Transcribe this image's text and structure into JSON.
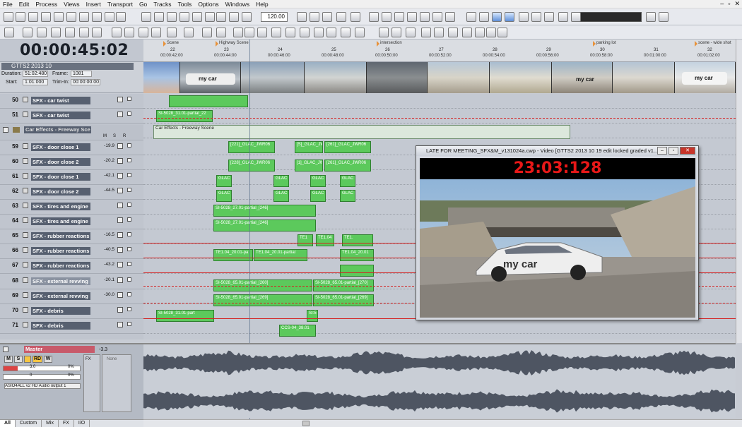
{
  "menu": [
    "File",
    "Edit",
    "Process",
    "Views",
    "Insert",
    "Transport",
    "Go",
    "Tracks",
    "Tools",
    "Options",
    "Windows",
    "Help"
  ],
  "toolbar": {
    "tempo": "120.00"
  },
  "transport": {
    "timecode": "00:00:45:02"
  },
  "clip_info": {
    "name": "GTTS2 2013 10",
    "duration_label": "Duration:",
    "duration": "51:02:480",
    "frame_label": "Frame:",
    "frame": "1081",
    "start_label": "Start:",
    "start": "1:01:000",
    "trim_label": "Trim-In:",
    "trim_in": "00:00:00:00"
  },
  "ruler": {
    "markers": [
      {
        "label": "Scene"
      },
      {
        "label": "Highway Scene"
      },
      {
        "label": "intersection"
      },
      {
        "label": "parking lot"
      },
      {
        "label": "scene - wide shot"
      }
    ],
    "ticks": [
      "22",
      "23",
      "24",
      "25",
      "26",
      "27",
      "28",
      "29",
      "30",
      "31",
      "32"
    ],
    "times": [
      "00:00:42:00",
      "00:00:44:00",
      "00:00:46:00",
      "00:00:48:00",
      "00:00:50:00",
      "00:00:52:00",
      "00:00:54:00",
      "00:00:56:00",
      "00:00:58:00",
      "00:01:00:00",
      "00:01:02:00"
    ]
  },
  "tracks": [
    {
      "num": "50",
      "name": "SFX - car twist",
      "vol": ""
    },
    {
      "num": "51",
      "name": "SFX - car twist",
      "vol": ""
    },
    {
      "num": "59",
      "name": "SFX - door close 1",
      "vol": "-19.9"
    },
    {
      "num": "60",
      "name": "SFX - door close 2",
      "vol": "-20.2"
    },
    {
      "num": "61",
      "name": "SFX - door close 1",
      "vol": "-42.1"
    },
    {
      "num": "62",
      "name": "SFX - door close 2",
      "vol": "-44.5"
    },
    {
      "num": "63",
      "name": "SFX - tires and engine",
      "vol": ""
    },
    {
      "num": "64",
      "name": "SFX - tires and engine",
      "vol": ""
    },
    {
      "num": "65",
      "name": "SFX - rubber reactions",
      "vol": "-16.5"
    },
    {
      "num": "66",
      "name": "SFX - rubber reactions",
      "vol": "-40.5"
    },
    {
      "num": "67",
      "name": "SFX - rubber reactions",
      "vol": "-43.2"
    },
    {
      "num": "68",
      "name": "SFX - external revving",
      "vol": "-20.1"
    },
    {
      "num": "69",
      "name": "SFX - external revving",
      "vol": "-30.0"
    },
    {
      "num": "70",
      "name": "SFX - debris",
      "vol": ""
    },
    {
      "num": "71",
      "name": "SFX - debris",
      "vol": ""
    }
  ],
  "group": {
    "name": "Car Effects - Freeway Sce",
    "clip": "Car Effects - Freeway Scene",
    "btns": [
      "M",
      "S",
      "R"
    ]
  },
  "clips": {
    "c50": "",
    "c51": "SI-5028_31.01-partial_22",
    "c59a": "[221]_GLAC_JWR06",
    "c59b": "[S]_GLAC_JW",
    "c59c": "[261]_GLAC_JWR06",
    "c60a": "[228]_GLAC_JWR06",
    "c60b": "[1]_GLAC_JW",
    "c60c": "[261]_GLAC_JWR06",
    "c61a": "GLAC",
    "c61b": "GLAC",
    "c61c": "GLAC",
    "c61d": "GLAC",
    "c62a": "GLAC",
    "c62b": "GLAC",
    "c62c": "GLAC",
    "c62d": "GLAC",
    "c63": "SI-5028_27.01-partial_[246]",
    "c64": "SI-5028_27.01-partial_[246]",
    "c65a": "TE1",
    "c65b": "TE1.04",
    "c65c": "TE1.",
    "c66a": "TE1.04_20.01-pa",
    "c66b": "TE1.04_20.01-partial",
    "c66c": "TE1.04_20.01",
    "c68a": "SI-5028_65.01-partial_[260]",
    "c68b": "SI-5028_65.01-partial_[270]",
    "c69a": "SI-5028_65.01-partial_[269]",
    "c69b": "SI-5028_65.01-partial_[269]",
    "c70a": "SI-5028_31.01-part",
    "c70b": "SI:5",
    "c71": "CCS-04_38.01"
  },
  "video": {
    "title": "LATE FOR MEETING_SFX&M_v131024a.cwp - Video [GTTS2 2013 10 19 edit locked graded v1...",
    "timecode": "23:03:128",
    "car_text": "my car",
    "thumb_car_texts": [
      "my car",
      "my car",
      "my car"
    ]
  },
  "master": {
    "name": "Master",
    "vol": "-3.3",
    "btns": [
      "M",
      "S",
      "RD",
      "W"
    ],
    "fx_label": "FX",
    "none_label": "None",
    "val1": "3.0",
    "pct1": "0%",
    "val2": "0",
    "pct2": "0%",
    "output": "ASIO4ALL v2 HD Audio output 1"
  },
  "tabs": [
    "All",
    "Custom",
    "Mix",
    "FX",
    "I/O"
  ]
}
